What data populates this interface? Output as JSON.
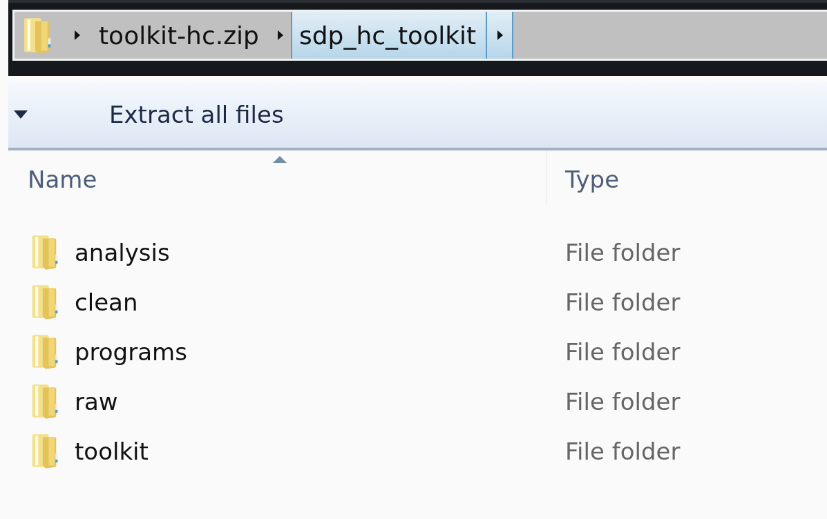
{
  "address_bar": {
    "crumbs": [
      {
        "label": "toolkit-hc.zip",
        "selected": false
      },
      {
        "label": "sdp_hc_toolkit",
        "selected": true
      }
    ]
  },
  "toolbar": {
    "actions": [
      "Extract all files"
    ]
  },
  "file_list": {
    "columns": [
      {
        "label": "Name",
        "sorted": true
      },
      {
        "label": "Type",
        "sorted": false
      }
    ],
    "rows": [
      {
        "name": "analysis",
        "type": "File folder"
      },
      {
        "name": "clean",
        "type": "File folder"
      },
      {
        "name": "programs",
        "type": "File folder"
      },
      {
        "name": "raw",
        "type": "File folder"
      },
      {
        "name": "toolkit",
        "type": "File folder"
      }
    ]
  }
}
